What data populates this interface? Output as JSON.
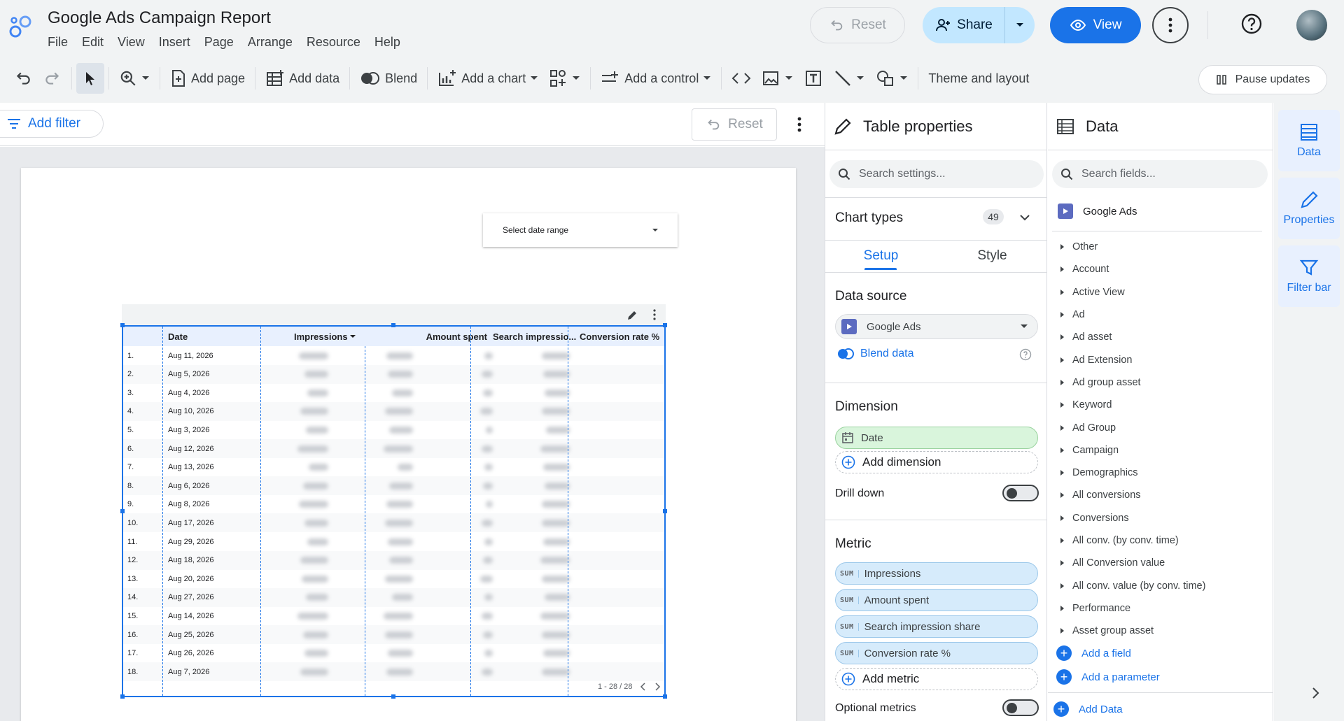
{
  "header": {
    "title": "Google Ads Campaign Report",
    "menu": [
      "File",
      "Edit",
      "View",
      "Insert",
      "Page",
      "Arrange",
      "Resource",
      "Help"
    ],
    "reset_label": "Reset",
    "share_label": "Share",
    "view_label": "View"
  },
  "toolbar": {
    "add_page": "Add page",
    "add_data": "Add data",
    "blend": "Blend",
    "add_chart": "Add a chart",
    "add_control": "Add a control",
    "theme_layout": "Theme and layout",
    "pause_updates": "Pause updates"
  },
  "filterbar": {
    "add_filter": "Add filter",
    "reset": "Reset"
  },
  "canvas": {
    "date_range_label": "Select date range",
    "table": {
      "columns": [
        "Date",
        "Impressions",
        "Amount spent",
        "Search impressio...",
        "Conversion rate %"
      ],
      "rows": [
        {
          "n": "1.",
          "date": "Aug 11, 2026"
        },
        {
          "n": "2.",
          "date": "Aug 5, 2026"
        },
        {
          "n": "3.",
          "date": "Aug 4, 2026"
        },
        {
          "n": "4.",
          "date": "Aug 10, 2026"
        },
        {
          "n": "5.",
          "date": "Aug 3, 2026"
        },
        {
          "n": "6.",
          "date": "Aug 12, 2026"
        },
        {
          "n": "7.",
          "date": "Aug 13, 2026"
        },
        {
          "n": "8.",
          "date": "Aug 6, 2026"
        },
        {
          "n": "9.",
          "date": "Aug 8, 2026"
        },
        {
          "n": "10.",
          "date": "Aug 17, 2026"
        },
        {
          "n": "11.",
          "date": "Aug 29, 2026"
        },
        {
          "n": "12.",
          "date": "Aug 18, 2026"
        },
        {
          "n": "13.",
          "date": "Aug 20, 2026"
        },
        {
          "n": "14.",
          "date": "Aug 27, 2026"
        },
        {
          "n": "15.",
          "date": "Aug 14, 2026"
        },
        {
          "n": "16.",
          "date": "Aug 25, 2026"
        },
        {
          "n": "17.",
          "date": "Aug 26, 2026"
        },
        {
          "n": "18.",
          "date": "Aug 7, 2026"
        }
      ],
      "pager": "1 - 28 / 28"
    }
  },
  "properties": {
    "title": "Table properties",
    "search_placeholder": "Search settings...",
    "chart_types_label": "Chart types",
    "chart_types_count": "49",
    "tabs": [
      "Setup",
      "Style"
    ],
    "data_source_label": "Data source",
    "data_source_value": "Google Ads",
    "blend_data": "Blend data",
    "dimension_label": "Dimension",
    "dimension_value": "Date",
    "add_dimension": "Add dimension",
    "drill_down": "Drill down",
    "metric_label": "Metric",
    "sum_label": "SUM",
    "metrics": [
      "Impressions",
      "Amount spent",
      "Search impression share",
      "Conversion rate %"
    ],
    "add_metric": "Add metric",
    "optional_metrics": "Optional metrics"
  },
  "datapanel": {
    "title": "Data",
    "search_placeholder": "Search fields...",
    "source_name": "Google Ads",
    "groups": [
      "Other",
      "Account",
      "Active View",
      "Ad",
      "Ad asset",
      "Ad Extension",
      "Ad group asset",
      "Keyword",
      "Ad Group",
      "Campaign",
      "Demographics",
      "All conversions",
      "Conversions",
      "All conv. (by conv. time)",
      "All Conversion value",
      "All conv. value (by conv. time)",
      "Performance",
      "Asset group asset"
    ],
    "add_field": "Add a field",
    "add_parameter": "Add a parameter",
    "add_data": "Add Data"
  },
  "rail": {
    "data": "Data",
    "properties": "Properties",
    "filter_bar": "Filter bar"
  },
  "colors": {
    "accent": "#1a73e8",
    "dimension_pill": "#d9f5dc",
    "metric_pill": "#d6ebfb"
  }
}
